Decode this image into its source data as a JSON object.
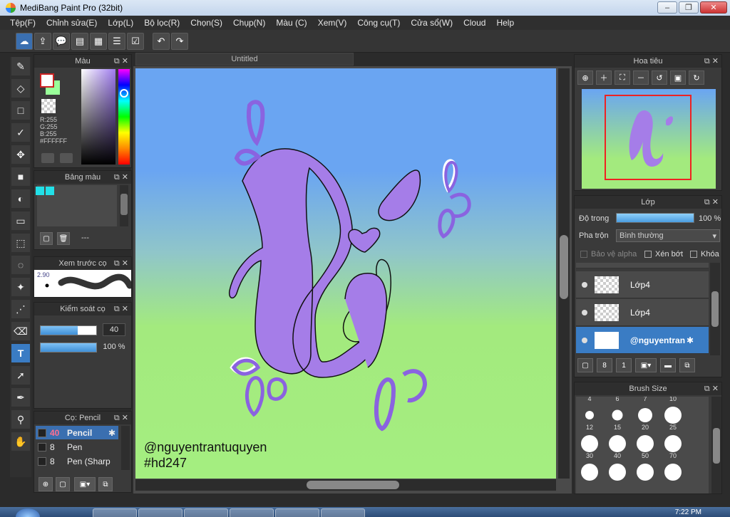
{
  "window": {
    "title": "MediBang Paint Pro (32bit)"
  },
  "menu": [
    "Tệp(F)",
    "Chỉnh sửa(E)",
    "Lớp(L)",
    "Bộ lọc(R)",
    "Chọn(S)",
    "Chụp(N)",
    "Màu (C)",
    "Xem(V)",
    "Công cụ(T)",
    "Cửa sổ(W)",
    "Cloud",
    "Help"
  ],
  "panels": {
    "color": {
      "title": "Màu",
      "r": "R:255",
      "g": "G:255",
      "b": "B:255",
      "hex": "#FFFFFF"
    },
    "palette": {
      "title": "Bảng màu",
      "dash": "---",
      "chip_color": "#22e0e8"
    },
    "preview": {
      "title": "Xem trước cọ",
      "size": "2.90"
    },
    "control": {
      "title": "Kiểm soát cọ",
      "size_value": "40",
      "opacity_value": "100 %",
      "size_fill": 0.67,
      "opacity_fill": 1.0
    },
    "brush": {
      "title": "Cọ: Pencil",
      "items": [
        {
          "num": "40",
          "name": "Pencil",
          "selected": true
        },
        {
          "num": "8",
          "name": "Pen",
          "selected": false
        },
        {
          "num": "8",
          "name": "Pen (Sharp",
          "selected": false
        }
      ]
    },
    "navigator": {
      "title": "Hoa tiêu"
    },
    "layer": {
      "title": "Lớp",
      "opacity_label": "Độ trong",
      "opacity_value": "100 %",
      "blend_label": "Pha trộn",
      "blend_value": "Bình thường",
      "protect_alpha": "Bảo vệ alpha",
      "clipping": "Xén bớt",
      "lock": "Khóa",
      "layers": [
        {
          "name": "Lớp4",
          "selected": false
        },
        {
          "name": "Lớp4",
          "selected": false
        },
        {
          "name": "@nguyentran",
          "selected": true
        }
      ]
    },
    "brush_size": {
      "title": "Brush Size",
      "sizes": [
        {
          "label": "12",
          "dot": 12
        },
        {
          "label": "15",
          "dot": 15
        },
        {
          "label": "20",
          "dot": 20
        },
        {
          "label": "25",
          "dot": 24
        },
        {
          "label": "30",
          "dot": 24
        },
        {
          "label": "40",
          "dot": 24
        },
        {
          "label": "50",
          "dot": 24
        },
        {
          "label": "70",
          "dot": 24
        },
        {
          "label": "",
          "dot": 24
        },
        {
          "label": "",
          "dot": 24
        },
        {
          "label": "",
          "dot": 24
        },
        {
          "label": "",
          "dot": 24
        }
      ],
      "top_labels": [
        "4",
        "6",
        "7",
        "10"
      ]
    }
  },
  "canvas": {
    "tab": "Untitled",
    "watermark_line1": "@nguyentrantuquyen",
    "watermark_line2": "#hd247",
    "letter_color": "#a57de8",
    "drop_color": "#8a63e0"
  },
  "taskbar": {
    "clock": "7:22 PM"
  }
}
